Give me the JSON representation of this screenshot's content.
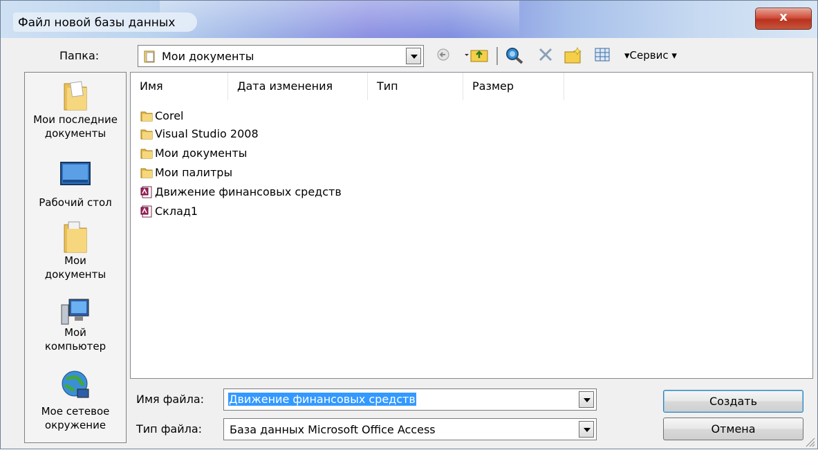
{
  "window": {
    "title": "Файл новой базы данных",
    "close_label": "x"
  },
  "toolbar": {
    "folder_label": "Папка:",
    "folder_value": "Мои документы",
    "service_label": "▾Сервис ▾"
  },
  "places": [
    {
      "label_line1": "Мои последние",
      "label_line2": "документы",
      "icon": "recent-folder-icon"
    },
    {
      "label_line1": "Рабочий стол",
      "label_line2": "",
      "icon": "desktop-icon"
    },
    {
      "label_line1": "Мои",
      "label_line2": "документы",
      "icon": "my-documents-icon"
    },
    {
      "label_line1": "Мой",
      "label_line2": "компьютер",
      "icon": "my-computer-icon"
    },
    {
      "label_line1": "Мое сетевое",
      "label_line2": "окружение",
      "icon": "network-icon"
    }
  ],
  "filelist": {
    "columns": [
      "Имя",
      "Дата изменения",
      "Тип",
      "Размер"
    ],
    "items": [
      {
        "name": "Corel",
        "kind": "folder"
      },
      {
        "name": "Visual Studio 2008",
        "kind": "folder"
      },
      {
        "name": "Мои документы",
        "kind": "folder"
      },
      {
        "name": "Мои палитры",
        "kind": "folder"
      },
      {
        "name": "Движение финансовых средств",
        "kind": "access-db"
      },
      {
        "name": "Склад1",
        "kind": "access-db"
      }
    ]
  },
  "footer": {
    "filename_label": "Имя файла:",
    "filename_value": "Движение финансовых средств",
    "filetype_label": "Тип файла:",
    "filetype_value": "База данных Microsoft Office Access",
    "create_label": "Создать",
    "cancel_label": "Отмена"
  },
  "colors": {
    "selection": "#3399ff",
    "close": "#c8553a"
  }
}
